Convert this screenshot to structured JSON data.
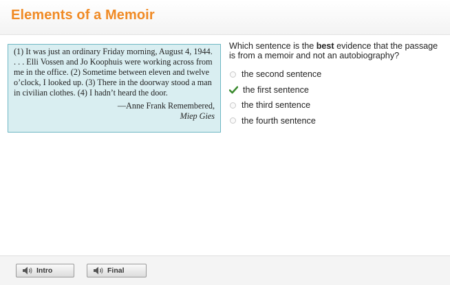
{
  "header": {
    "title": "Elements of a Memoir"
  },
  "passage": {
    "text": "(1) It was just an ordinary Friday morning, August 4, 1944. . . . Elli Vossen and Jo Koophuis were working across from me in the office. (2) Sometime between eleven and twelve o’clock, I looked up. (3) There in the doorway stood a man in civilian clothes. (4) I hadn’t heard the door.",
    "attribution": "—Anne Frank Remembered,",
    "source": "Miep Gies"
  },
  "question": {
    "prefix": "Which sentence is the ",
    "emphasis": "best",
    "suffix": " evidence that the passage is from a memoir and not an autobiography?"
  },
  "options": [
    {
      "label": "the second sentence",
      "state": "unselected"
    },
    {
      "label": "the first sentence",
      "state": "correct"
    },
    {
      "label": "the third sentence",
      "state": "unselected"
    },
    {
      "label": "the fourth sentence",
      "state": "unselected"
    }
  ],
  "footer": {
    "intro_label": "Intro",
    "final_label": "Final"
  },
  "colors": {
    "title": "#f08a24",
    "passage_bg": "#d9eef1",
    "passage_border": "#6cb6c3",
    "check": "#3a8a2e"
  },
  "icons": {
    "check": "check-icon",
    "speaker": "speaker-icon"
  }
}
